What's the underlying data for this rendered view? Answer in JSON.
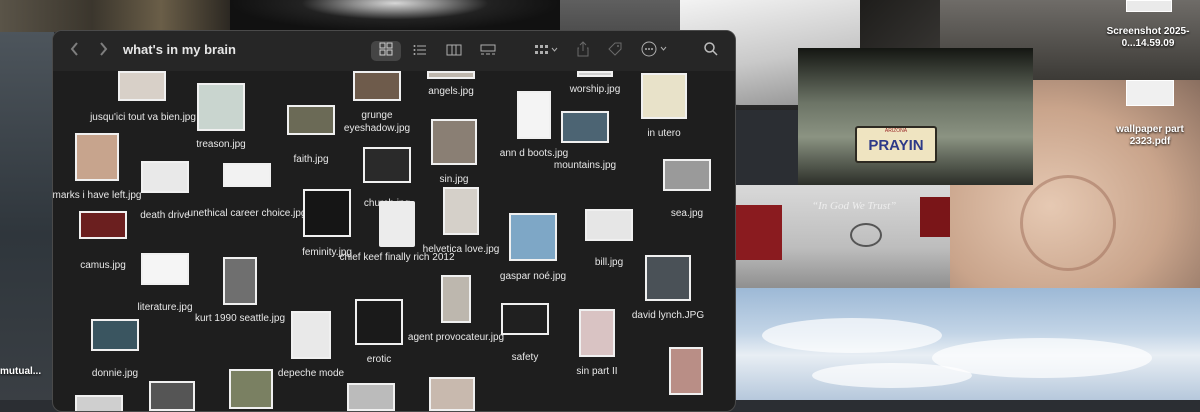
{
  "window": {
    "title": "what's in my brain",
    "back_icon": "chevron-left-icon",
    "forward_icon": "chevron-right-icon",
    "view_icons": [
      "grid-view-icon",
      "list-view-icon",
      "column-view-icon",
      "gallery-view-icon"
    ],
    "group_icon": "group-by-icon",
    "share_icon": "share-icon",
    "tag_icon": "tag-icon",
    "more_icon": "ellipsis-circle-icon",
    "search_icon": "search-icon"
  },
  "files": [
    {
      "name": "jusqu'ici tout va bien.jpg",
      "thumb": "#d8d0c8"
    },
    {
      "name": "treason.jpg",
      "thumb": "#c9d5cf"
    },
    {
      "name": "faith.jpg",
      "thumb": "#6b6a56"
    },
    {
      "name": "grunge eyeshadow.jpg",
      "thumb": "#6e5b4b"
    },
    {
      "name": "angels.jpg",
      "thumb": "#bfb7ad"
    },
    {
      "name": "worship.jpg",
      "thumb": "#cfcfcf"
    },
    {
      "name": "in utero",
      "thumb": "#e8e2c9"
    },
    {
      "name": "marks i have left.jpg",
      "thumb": "#c7a48d"
    },
    {
      "name": "death drive",
      "thumb": "#e9e9e9"
    },
    {
      "name": "unethical career choice.jpg",
      "thumb": "#f2f2f2"
    },
    {
      "name": "sin.jpg",
      "thumb": "#8a7f74"
    },
    {
      "name": "church.jpg",
      "thumb": "#2a2a2a"
    },
    {
      "name": "ann d boots.jpg",
      "thumb": "#f4f4f4"
    },
    {
      "name": "mountains.jpg",
      "thumb": "#4c6473"
    },
    {
      "name": "sea.jpg",
      "thumb": "#9a9a9a"
    },
    {
      "name": "camus.jpg",
      "thumb": "#6b1f1f"
    },
    {
      "name": "feminity.jpg",
      "thumb": "#151515"
    },
    {
      "name": "chief keef finally rich 2012",
      "thumb": "#ededed"
    },
    {
      "name": "helvetica love.jpg",
      "thumb": "#d5d0c9"
    },
    {
      "name": "gaspar noé.jpg",
      "thumb": "#7ea7c6"
    },
    {
      "name": "bill.jpg",
      "thumb": "#e6e6e6"
    },
    {
      "name": "literature.jpg",
      "thumb": "#f5f5f5"
    },
    {
      "name": "kurt 1990 seattle.jpg",
      "thumb": "#6f6f6f"
    },
    {
      "name": "david lynch.JPG",
      "thumb": "#4a5157"
    },
    {
      "name": "donnie.jpg",
      "thumb": "#3a5560"
    },
    {
      "name": "depeche mode",
      "thumb": "#e9e9e9"
    },
    {
      "name": "erotic",
      "thumb": "#1a1a1a"
    },
    {
      "name": "agent provocateur.jpg",
      "thumb": "#bdb7ae"
    },
    {
      "name": "safety",
      "thumb": "#202020"
    },
    {
      "name": "sin part II",
      "thumb": "#d9c3c3"
    }
  ],
  "desktop": {
    "items": [
      {
        "name": "Screenshot 2025-0...14.59.09"
      },
      {
        "name": "wallpaper part 2323.pdf"
      },
      {
        "name": "mutual..."
      }
    ],
    "plate_text": "PRAYIN",
    "plate_state": "ARIZONA",
    "motto": "“In God We Trust”"
  }
}
